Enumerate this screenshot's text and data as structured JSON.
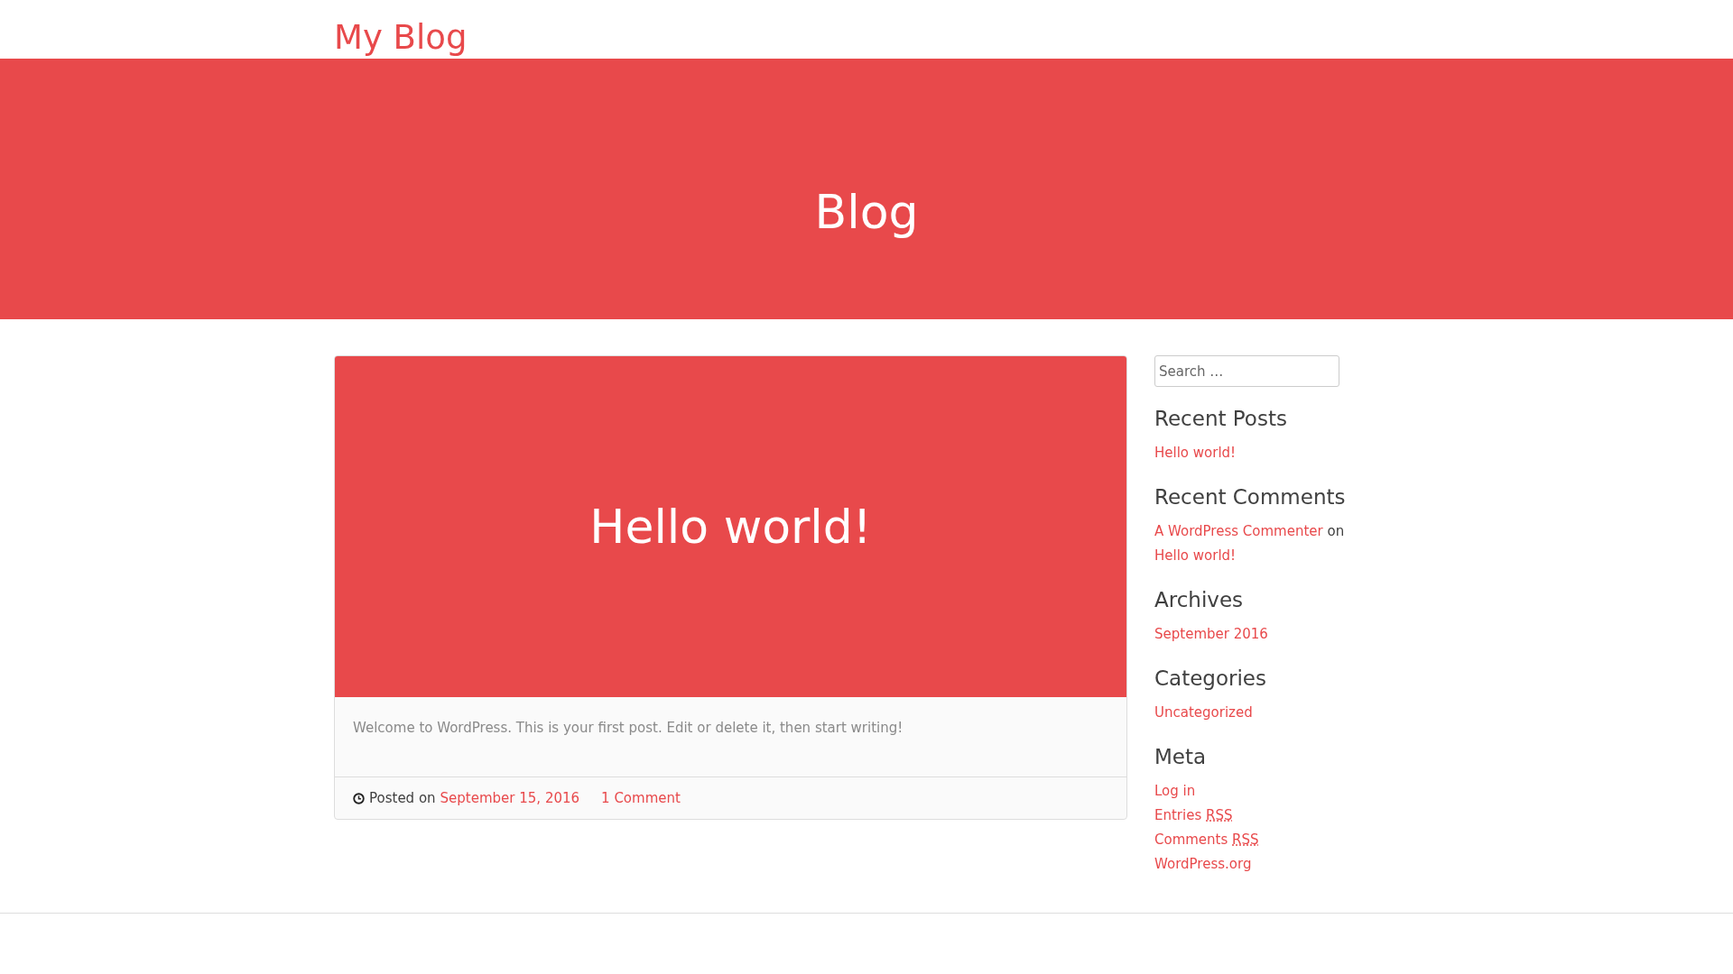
{
  "site_title": "My Blog",
  "hero": {
    "title": "Blog"
  },
  "post": {
    "title": "Hello world!",
    "excerpt": "Welcome to WordPress. This is your first post. Edit or delete it, then start writing!",
    "posted_label": "Posted on",
    "date": "September 15, 2016",
    "comments": "1 Comment"
  },
  "sidebar": {
    "search": {
      "placeholder": "Search …"
    },
    "recent_posts": {
      "title": "Recent Posts",
      "items": [
        "Hello world!"
      ]
    },
    "recent_comments": {
      "title": "Recent Comments",
      "items": [
        {
          "author": "A WordPress Commenter",
          "joiner": "on",
          "post": "Hello world!"
        }
      ]
    },
    "archives": {
      "title": "Archives",
      "items": [
        "September 2016"
      ]
    },
    "categories": {
      "title": "Categories",
      "items": [
        "Uncategorized"
      ]
    },
    "meta": {
      "title": "Meta",
      "items": [
        {
          "label": "Log in"
        },
        {
          "label": "Entries",
          "abbr": "RSS"
        },
        {
          "label": "Comments",
          "abbr": "RSS"
        },
        {
          "label": "WordPress.org"
        }
      ]
    }
  }
}
